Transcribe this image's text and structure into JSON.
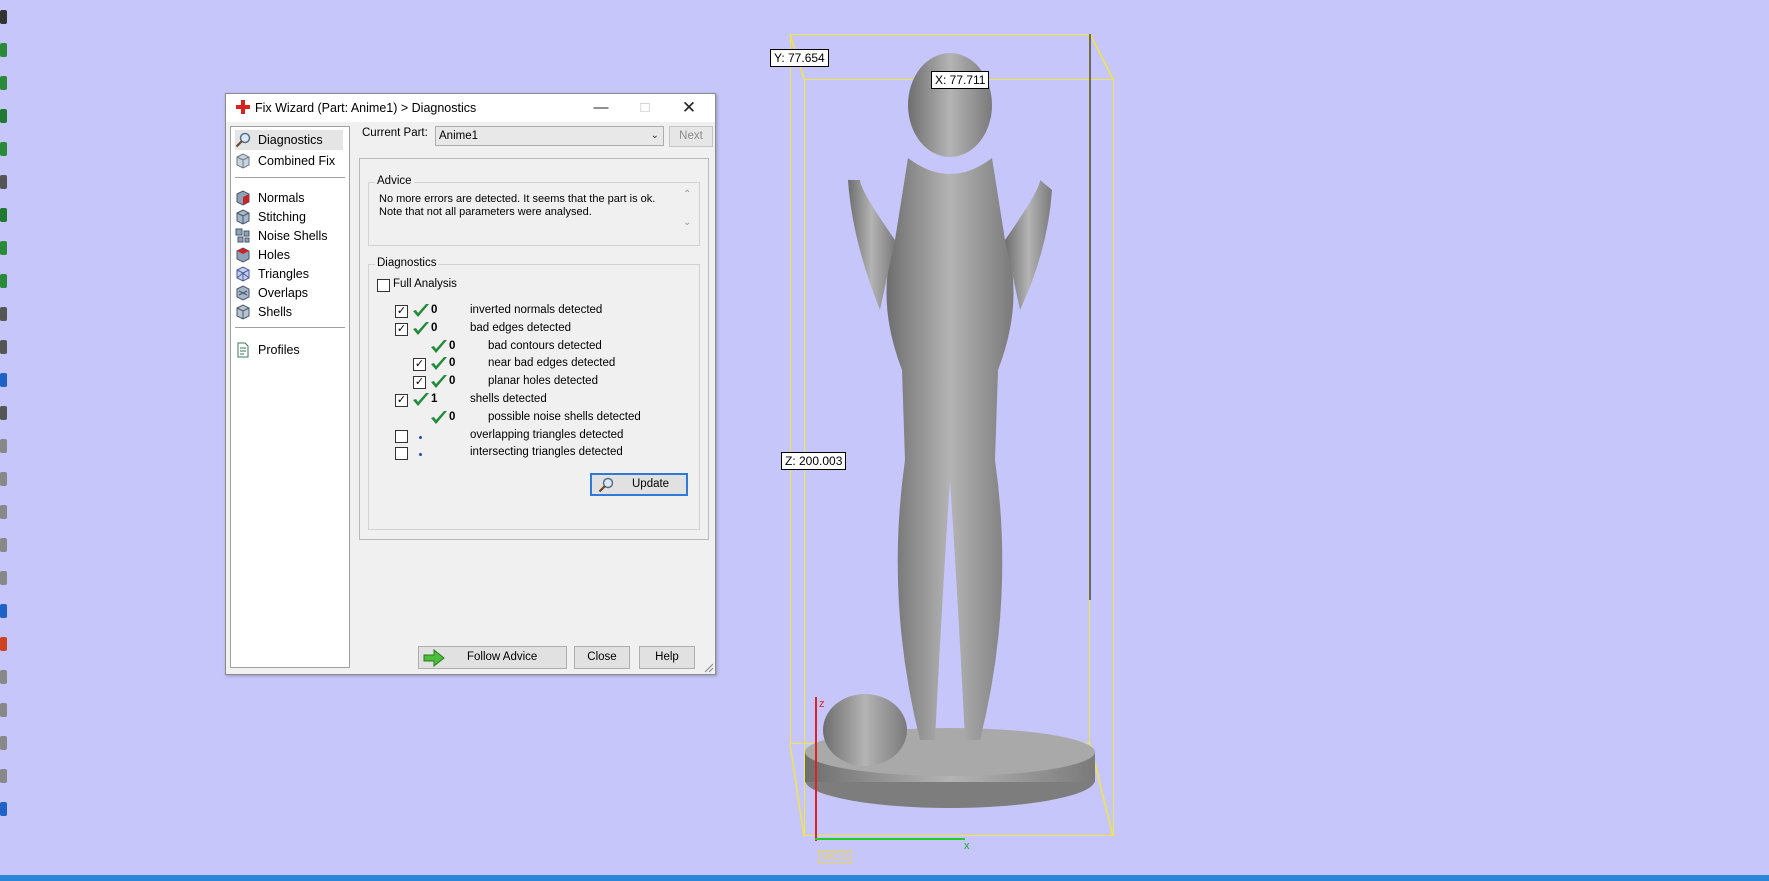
{
  "viewport": {
    "label_y": "Y: 77.654",
    "label_x": "X: 77.711",
    "label_z": "Z: 200.003",
    "axis_z": "z",
    "axis_x": "x",
    "wcs": "WCS",
    "colors": {
      "background": "#c6c6fa",
      "bounding_box": "#f2e640",
      "model": "#9a9a9a"
    }
  },
  "dialog": {
    "title": "Fix Wizard (Part: Anime1) > Diagnostics",
    "nav": {
      "top_items": [
        {
          "label": "Diagnostics",
          "icon": "magnifier-icon",
          "selected": true
        },
        {
          "label": "Combined Fix",
          "icon": "cube-icon"
        }
      ],
      "fix_items": [
        {
          "label": "Normals",
          "icon": "normals-cube-icon"
        },
        {
          "label": "Stitching",
          "icon": "stitching-cube-icon"
        },
        {
          "label": "Noise Shells",
          "icon": "noise-shells-icon"
        },
        {
          "label": "Holes",
          "icon": "holes-cube-icon"
        },
        {
          "label": "Triangles",
          "icon": "triangles-cube-icon"
        },
        {
          "label": "Overlaps",
          "icon": "overlaps-cube-icon"
        },
        {
          "label": "Shells",
          "icon": "shells-cube-icon"
        }
      ],
      "profiles": {
        "label": "Profiles",
        "icon": "document-icon"
      }
    },
    "current_part_label": "Current Part:",
    "current_part_value": "Anime1",
    "next_label": "Next",
    "advice": {
      "title": "Advice",
      "line1": "No more errors are detected. It seems that the part is ok.",
      "line2": "Note that not all parameters were analysed."
    },
    "diagnostics": {
      "title": "Diagnostics",
      "full_analysis": "Full Analysis",
      "rows": [
        {
          "checkbox": true,
          "checked": true,
          "status": "ok",
          "count": "0",
          "label": "inverted normals detected",
          "level": 0
        },
        {
          "checkbox": true,
          "checked": true,
          "status": "ok",
          "count": "0",
          "label": "bad edges detected",
          "level": 0
        },
        {
          "checkbox": false,
          "checked": false,
          "status": "ok",
          "count": "0",
          "label": "bad contours detected",
          "level": 1
        },
        {
          "checkbox": true,
          "checked": true,
          "status": "ok",
          "count": "0",
          "label": "near bad edges detected",
          "level": 1
        },
        {
          "checkbox": true,
          "checked": true,
          "status": "ok",
          "count": "0",
          "label": "planar holes detected",
          "level": 1
        },
        {
          "checkbox": true,
          "checked": true,
          "status": "ok",
          "count": "1",
          "label": "shells detected",
          "level": 0
        },
        {
          "checkbox": false,
          "checked": false,
          "status": "ok",
          "count": "0",
          "label": "possible noise shells detected",
          "level": 1
        },
        {
          "checkbox": true,
          "checked": false,
          "status": "none",
          "count": "",
          "label": "overlapping triangles detected",
          "level": 0
        },
        {
          "checkbox": true,
          "checked": false,
          "status": "none",
          "count": "",
          "label": "intersecting triangles detected",
          "level": 0
        }
      ]
    },
    "update_label": "Update",
    "follow_advice_label": "Follow Advice",
    "close_label": "Close",
    "help_label": "Help"
  }
}
